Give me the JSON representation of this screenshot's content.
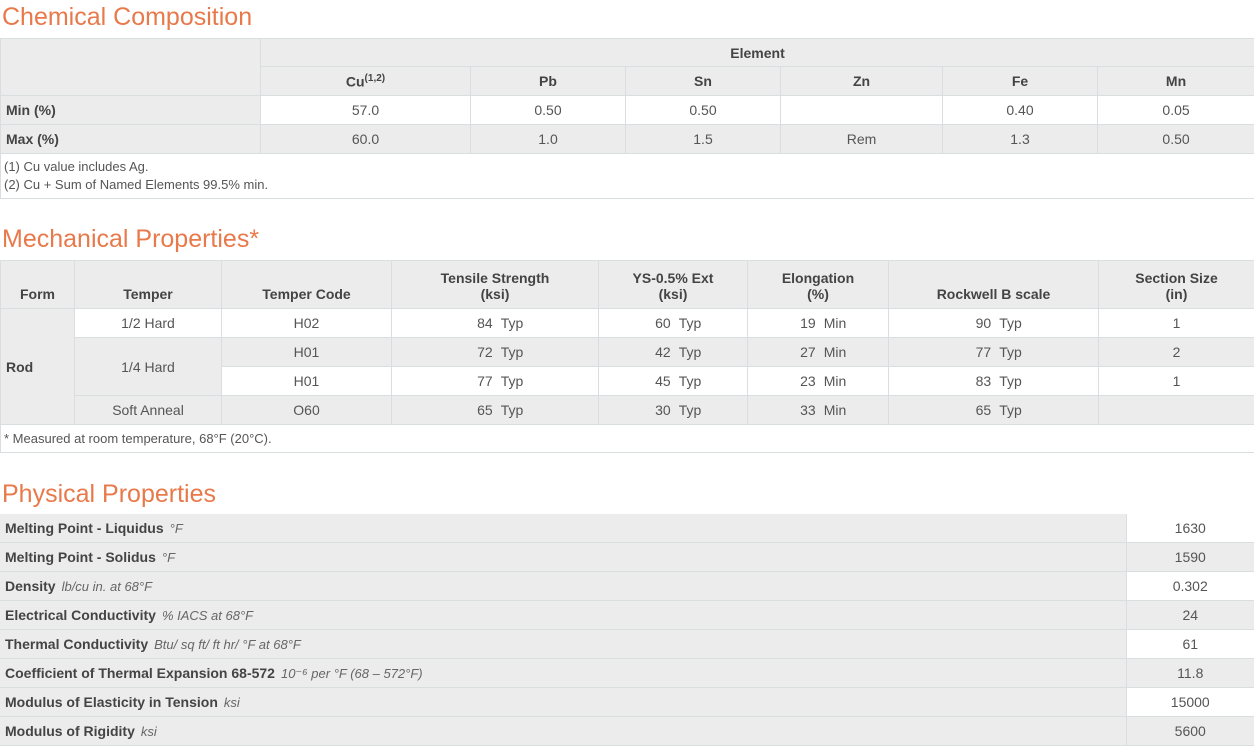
{
  "chemical": {
    "title": "Chemical Composition",
    "group_header": "Element",
    "columns": [
      "Cu",
      "Pb",
      "Sn",
      "Zn",
      "Fe",
      "Mn"
    ],
    "cu_sup": "(1,2)",
    "rows": [
      {
        "label": "Min (%)",
        "values": [
          "57.0",
          "0.50",
          "0.50",
          "",
          "0.40",
          "0.05"
        ]
      },
      {
        "label": "Max (%)",
        "values": [
          "60.0",
          "1.0",
          "1.5",
          "Rem",
          "1.3",
          "0.50"
        ]
      }
    ],
    "notes": [
      "(1) Cu value includes Ag.",
      "(2) Cu + Sum of Named Elements 99.5% min."
    ]
  },
  "mechanical": {
    "title": "Mechanical Properties*",
    "headers": {
      "form": "Form",
      "temper": "Temper",
      "temper_code": "Temper Code",
      "tensile_1": "Tensile Strength",
      "tensile_2": "(ksi)",
      "ys_1": "YS-0.5% Ext",
      "ys_2": "(ksi)",
      "elong_1": "Elongation",
      "elong_2": "(%)",
      "rockwell": "Rockwell B scale",
      "section_1": "Section Size",
      "section_2": "(in)"
    },
    "form": "Rod",
    "rows": [
      {
        "temper": "1/2 Hard",
        "code": "H02",
        "tensile": "84",
        "tensile_q": "Typ",
        "ys": "60",
        "ys_q": "Typ",
        "elong": "19",
        "elong_q": "Min",
        "rock": "90",
        "rock_q": "Typ",
        "section": "1"
      },
      {
        "temper": "1/4 Hard",
        "code": "H01",
        "tensile": "72",
        "tensile_q": "Typ",
        "ys": "42",
        "ys_q": "Typ",
        "elong": "27",
        "elong_q": "Min",
        "rock": "77",
        "rock_q": "Typ",
        "section": "2"
      },
      {
        "temper": "",
        "code": "H01",
        "tensile": "77",
        "tensile_q": "Typ",
        "ys": "45",
        "ys_q": "Typ",
        "elong": "23",
        "elong_q": "Min",
        "rock": "83",
        "rock_q": "Typ",
        "section": "1"
      },
      {
        "temper": "Soft Anneal",
        "code": "O60",
        "tensile": "65",
        "tensile_q": "Typ",
        "ys": "30",
        "ys_q": "Typ",
        "elong": "33",
        "elong_q": "Min",
        "rock": "65",
        "rock_q": "Typ",
        "section": ""
      }
    ],
    "note": "* Measured at room temperature, 68°F (20°C)."
  },
  "physical": {
    "title": "Physical Properties",
    "rows": [
      {
        "label": "Melting Point - Liquidus",
        "unit": "°F",
        "value": "1630"
      },
      {
        "label": "Melting Point - Solidus",
        "unit": "°F",
        "value": "1590"
      },
      {
        "label": "Density",
        "unit": "lb/cu in. at 68°F",
        "value": "0.302"
      },
      {
        "label": "Electrical Conductivity",
        "unit": "% IACS at 68°F",
        "value": "24"
      },
      {
        "label": "Thermal Conductivity",
        "unit": "Btu/ sq ft/ ft hr/ °F at 68°F",
        "value": "61"
      },
      {
        "label": "Coefficient of Thermal Expansion 68-572",
        "unit": "10⁻⁶ per °F (68 – 572°F)",
        "value": "11.8"
      },
      {
        "label": "Modulus of Elasticity in Tension",
        "unit": "ksi",
        "value": "15000"
      },
      {
        "label": "Modulus of Rigidity",
        "unit": "ksi",
        "value": "5600"
      }
    ]
  }
}
